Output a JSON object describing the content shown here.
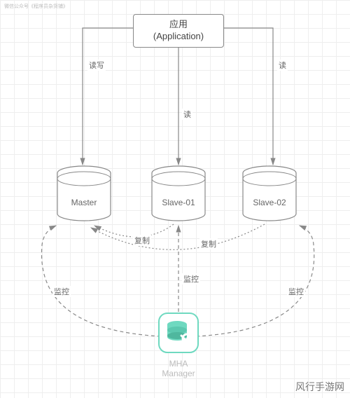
{
  "watermark_top": "微信公众号《程序员杂货铺》",
  "watermark_bottom": "风行手游网",
  "nodes": {
    "application": {
      "line1": "应用",
      "line2": "(Application)"
    },
    "master": {
      "label": "Master"
    },
    "slave1": {
      "label": "Slave-01"
    },
    "slave2": {
      "label": "Slave-02"
    },
    "mha": {
      "label1": "MHA",
      "label2": "Manager"
    }
  },
  "edges": {
    "app_master": "读写",
    "app_slave1": "读",
    "app_slave2": "读",
    "master_slave1_repl": "复制",
    "master_slave2_repl": "复制",
    "mha_master_mon": "监控",
    "mha_slave1_mon": "监控",
    "mha_slave2_mon": "监控"
  }
}
